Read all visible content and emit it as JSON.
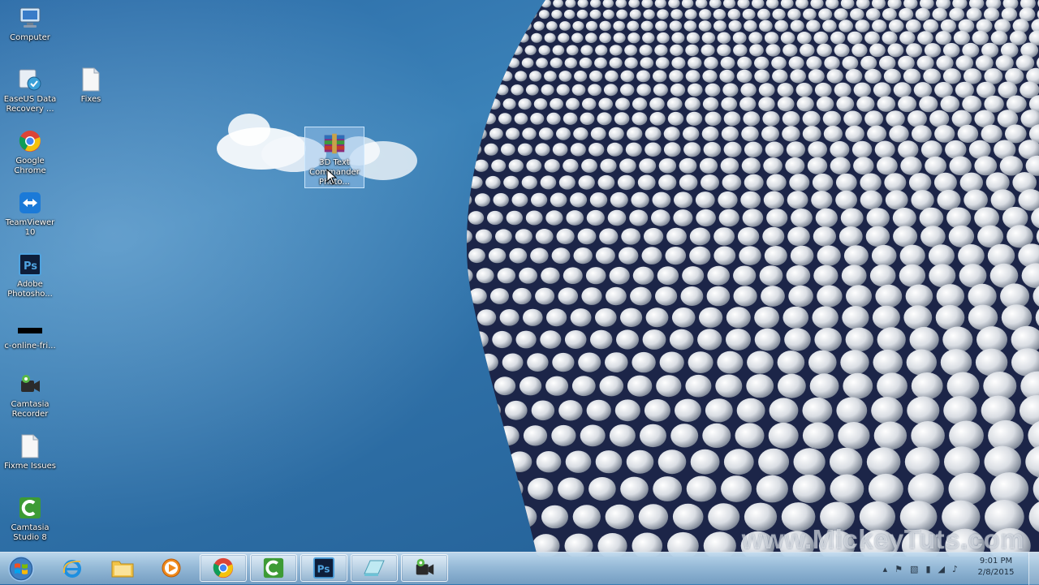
{
  "desktop": {
    "icons": [
      {
        "label": "Computer"
      },
      {
        "label": "EaseUS Data\nRecovery ..."
      },
      {
        "label": "Fixes"
      },
      {
        "label": "Google\nChrome"
      },
      {
        "label": "TeamViewer\n10"
      },
      {
        "label": "Adobe\nPhotosho..."
      },
      {
        "label": "c-online-fri..."
      },
      {
        "label": "Camtasia\nRecorder"
      },
      {
        "label": "Fixme Issues"
      },
      {
        "label": "Camtasia\nStudio 8"
      },
      {
        "label": "3D Text\nCommander\nPhoto..."
      }
    ],
    "selected_icon": "3D Text Commander Photo..."
  },
  "watermark": {
    "text": "www.MickeyTuts.com"
  },
  "taskbar": {
    "start_label": "Start",
    "pinned": [
      {
        "name": "Internet Explorer",
        "icon": "internet-explorer-icon"
      },
      {
        "name": "Windows Explorer",
        "icon": "folder-icon"
      },
      {
        "name": "Windows Media Player",
        "icon": "media-player-icon"
      },
      {
        "name": "Google Chrome",
        "icon": "chrome-icon"
      },
      {
        "name": "Camtasia Studio",
        "icon": "camtasia-icon"
      },
      {
        "name": "Adobe Photoshop",
        "icon": "photoshop-icon",
        "label": "Ps"
      },
      {
        "name": "Notepad",
        "icon": "notepad-icon"
      },
      {
        "name": "Camtasia Recorder",
        "icon": "recorder-icon"
      }
    ],
    "clock": {
      "time": "9:01 PM",
      "date": "2/8/2015"
    }
  },
  "colors": {
    "sky": "#2e6fa6",
    "taskbar": "#9dbcd8",
    "building_disc": "#d9dde3",
    "building_bg": "#1c2548"
  }
}
